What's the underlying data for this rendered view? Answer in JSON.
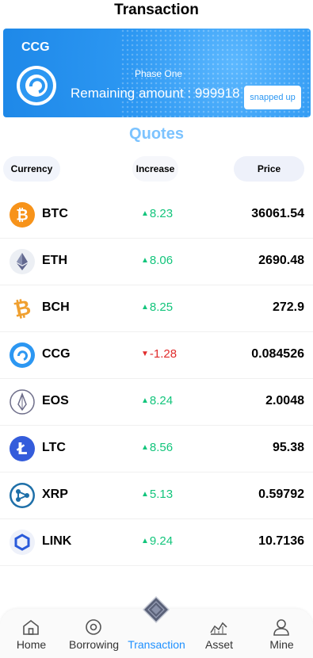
{
  "header": {
    "title": "Transaction"
  },
  "banner": {
    "code": "CCG",
    "phase": "Phase One",
    "remaining": "Remaining amount : 999918",
    "button_label": "snapped up"
  },
  "quotes": {
    "title": "Quotes"
  },
  "columns": {
    "currency": "Currency",
    "increase": "Increase",
    "price": "Price"
  },
  "rows": [
    {
      "symbol": "BTC",
      "increase": "8.23",
      "direction": "up",
      "price": "36061.54",
      "icon": "bitcoin-icon"
    },
    {
      "symbol": "ETH",
      "increase": "8.06",
      "direction": "up",
      "price": "2690.48",
      "icon": "ethereum-icon"
    },
    {
      "symbol": "BCH",
      "increase": "8.25",
      "direction": "up",
      "price": "272.9",
      "icon": "bitcoin-cash-icon"
    },
    {
      "symbol": "CCG",
      "increase": "-1.28",
      "direction": "down",
      "price": "0.084526",
      "icon": "ccg-icon"
    },
    {
      "symbol": "EOS",
      "increase": "8.24",
      "direction": "up",
      "price": "2.0048",
      "icon": "eos-icon"
    },
    {
      "symbol": "LTC",
      "increase": "8.56",
      "direction": "up",
      "price": "95.38",
      "icon": "litecoin-icon"
    },
    {
      "symbol": "XRP",
      "increase": "5.13",
      "direction": "up",
      "price": "0.59792",
      "icon": "ripple-icon"
    },
    {
      "symbol": "LINK",
      "increase": "9.24",
      "direction": "up",
      "price": "10.7136",
      "icon": "chainlink-icon"
    }
  ],
  "tabbar": [
    {
      "label": "Home",
      "icon": "home-icon",
      "active": false
    },
    {
      "label": "Borrowing",
      "icon": "target-icon",
      "active": false
    },
    {
      "label": "Transaction",
      "icon": "diamond-icon",
      "active": true
    },
    {
      "label": "Asset",
      "icon": "chart-icon",
      "active": false
    },
    {
      "label": "Mine",
      "icon": "user-icon",
      "active": false
    }
  ],
  "colors": {
    "accent": "#1e90ff",
    "up": "#13c57c",
    "down": "#e02b2b",
    "banner": "#2c97f2"
  }
}
